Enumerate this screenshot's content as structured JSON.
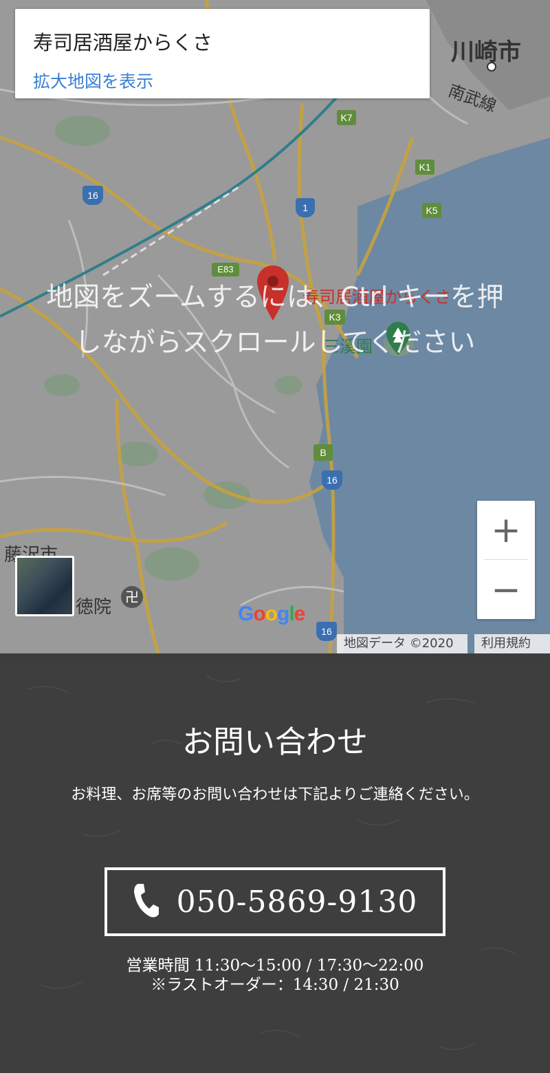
{
  "map": {
    "place_name": "寿司居酒屋からくさ",
    "larger_map_link": "拡大地図を表示",
    "overlay_line1": "地図をズームするには、Ctrl キーを押",
    "overlay_line2": "しながらスクロールしてください",
    "zoom_in": "+",
    "zoom_out": "−",
    "google_logo": "Google",
    "map_data": "地図データ ©2020",
    "terms": "利用規約",
    "labels": {
      "kawasaki": "川崎市",
      "nambu": "南武線",
      "fujisawa": "藤沢市",
      "tokuin": "徳院",
      "pin_label": "寿司居酒屋からくさ",
      "park": "三溪園"
    },
    "route_badges": [
      "K7",
      "K1",
      "K5",
      "16",
      "1",
      "E83",
      "K3",
      "B",
      "16",
      "16"
    ],
    "colors": {
      "land": "#9a9a9a",
      "water": "#6d88a2",
      "road": "#c7a23f",
      "rail": "#2e7f8a",
      "pin": "#c8302a"
    }
  },
  "contact": {
    "title": "お問い合わせ",
    "description": "お料理、お席等のお問い合わせは下記よりご連絡ください。",
    "phone": "050-5869-9130",
    "hours_line1": "営業時間 11:30〜15:00 / 17:30〜22:00",
    "hours_line2": "※ラストオーダー：14:30 / 21:30",
    "accent_color": "#b99b3a"
  }
}
